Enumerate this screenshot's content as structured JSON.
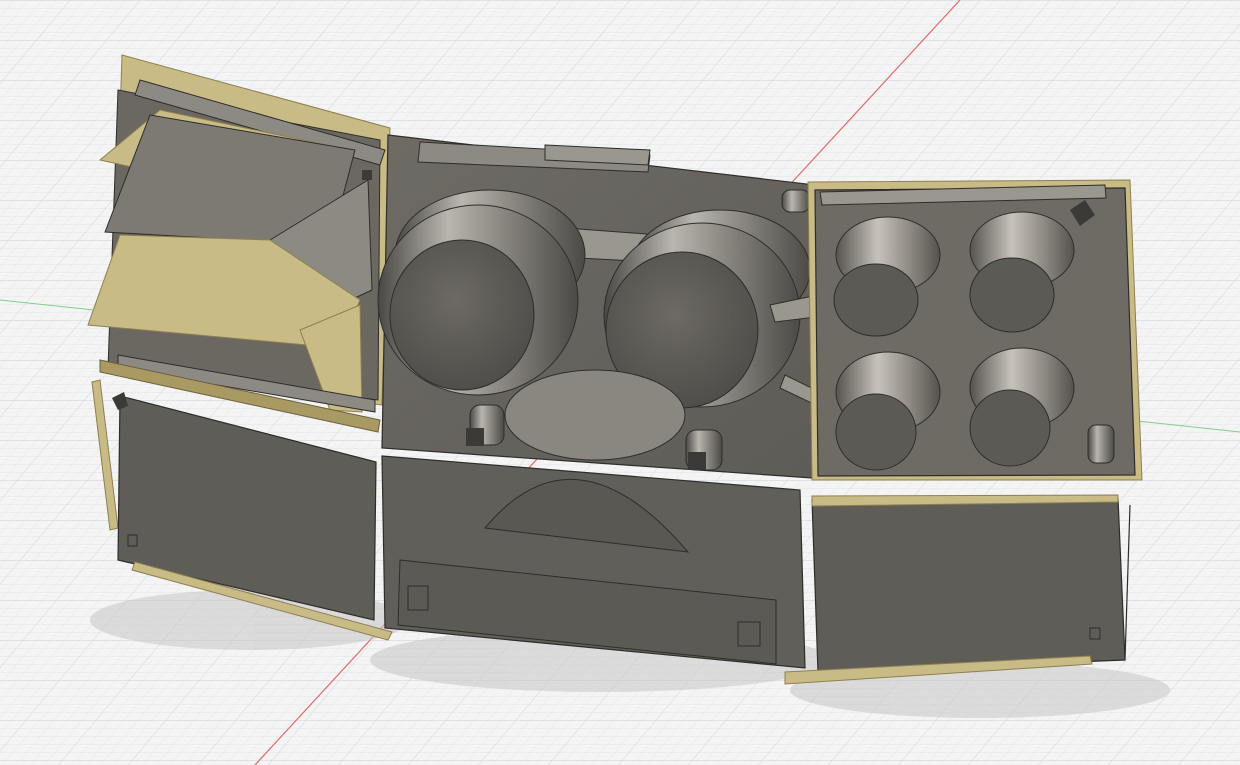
{
  "scene": {
    "type": "cad-3d-viewport",
    "colors": {
      "background": "#f4f4f4",
      "grid_minor": "#e2e4e8",
      "grid_major": "#cfd3da",
      "x_axis": "#e06a6a",
      "y_axis": "#7fcf8a",
      "z_axis": "#7fd1c6",
      "panel_dark": "#5c5a55",
      "panel_mid": "#6e6b65",
      "panel_light": "#8c8a83",
      "panel_edge": "#2e2d2a",
      "veneer": "#c9bb86",
      "veneer_dark": "#a99a63",
      "shadow": "#c6c6c6"
    },
    "parts": [
      "left-upper-hinged-assembly",
      "center-panel-with-speakers",
      "right-panel-with-knobs",
      "left-lower-panel",
      "center-lower-panel",
      "right-lower-panel"
    ]
  }
}
